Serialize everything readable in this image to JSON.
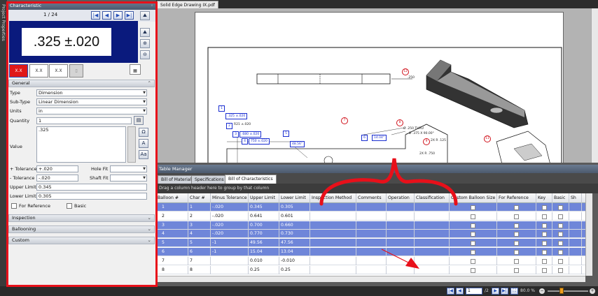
{
  "side_strip": {
    "label": "Project Properties"
  },
  "panel": {
    "title": "Characteristic",
    "counter": "1 / 24",
    "preview_value": ".325 ±.020",
    "general_label": "General",
    "fields": {
      "type_label": "Type",
      "type_value": "Dimension",
      "subtype_label": "Sub-Type",
      "subtype_value": "Linear Dimension",
      "units_label": "Units",
      "units_value": "in",
      "quantity_label": "Quantity",
      "quantity_value": "1",
      "value_label": "Value",
      "value_value": ".325",
      "plus_tol_label": "+ Tolerance",
      "plus_tol_value": "+.020",
      "hole_fit_label": "Hole Fit",
      "minus_tol_label": "- Tolerance",
      "minus_tol_value": "-.020",
      "shaft_fit_label": "Shaft Fit",
      "upper_label": "Upper Limit",
      "upper_value": "0.345",
      "lower_label": "Lower Limit",
      "lower_value": "0.305",
      "for_reference_label": "For Reference",
      "basic_label": "Basic"
    },
    "inspection_label": "Inspection",
    "ballooning_label": "Ballooning",
    "custom_label": "Custom"
  },
  "document": {
    "tab_label": "Solid Edge Drawing IX.pdf",
    "tags": {
      "t1": "1",
      "t2": ".325 ±.020",
      "t3": "2",
      "t3v": "R21 ±.020",
      "t4": "3",
      "t4v": ".680 ±.020",
      "t5": "4",
      "t5v": "750 ±.020",
      "t6": "5",
      "t6v": "48.56°",
      "t7": "6",
      "t7v": "14.04°"
    },
    "balloons": [
      "12",
      "7",
      "8",
      "9",
      "11"
    ],
    "annotations": {
      "a1": ".250",
      "a2": "Ø .250 THRU",
      "a3": "⌵ Ø .375 X 90.00°",
      "a4": "2X  R .125",
      "a5": "2X  R .750"
    }
  },
  "table_manager": {
    "title": "Table Manager",
    "tabs": [
      "Bill of Material",
      "Specifications",
      "Bill of Characteristics"
    ],
    "group_hint": "Drag a column header here to group by that column",
    "columns": [
      "Balloon #",
      "Char #",
      "Minus Tolerance",
      "Upper Limit",
      "Lower Limit",
      "Inspection Method",
      "Comments",
      "Operation",
      "Classification",
      "Custom Balloon Size",
      "For Reference",
      "Key",
      "Basic",
      "Sh"
    ],
    "rows": [
      {
        "balloon": "1",
        "char": "1",
        "minus": "-.020",
        "upper": "0.345",
        "lower": "0.305",
        "selected": true
      },
      {
        "balloon": "2",
        "char": "2",
        "minus": "-.020",
        "upper": "0.641",
        "lower": "0.601",
        "selected": false
      },
      {
        "balloon": "3",
        "char": "3",
        "minus": "-.020",
        "upper": "0.700",
        "lower": "0.660",
        "selected": true
      },
      {
        "balloon": "4",
        "char": "4",
        "minus": "-.020",
        "upper": "0.770",
        "lower": "0.730",
        "selected": true
      },
      {
        "balloon": "5",
        "char": "5",
        "minus": "-1",
        "upper": "49.56",
        "lower": "47.56",
        "selected": true
      },
      {
        "balloon": "6",
        "char": "6",
        "minus": "-1",
        "upper": "15.04",
        "lower": "13.04",
        "selected": true
      },
      {
        "balloon": "7",
        "char": "7",
        "minus": "",
        "upper": "0.010",
        "lower": "-0.010",
        "selected": false
      },
      {
        "balloon": "8",
        "char": "8",
        "minus": "",
        "upper": "0.25",
        "lower": "0.25",
        "selected": false
      }
    ]
  },
  "status": {
    "page_current": "1",
    "page_total": "/2",
    "zoom": "80.0 %"
  },
  "colors": {
    "highlight_red": "#e8101a",
    "selection_blue": "#6f86d9",
    "balloon_blue": "#1a2ed0"
  }
}
